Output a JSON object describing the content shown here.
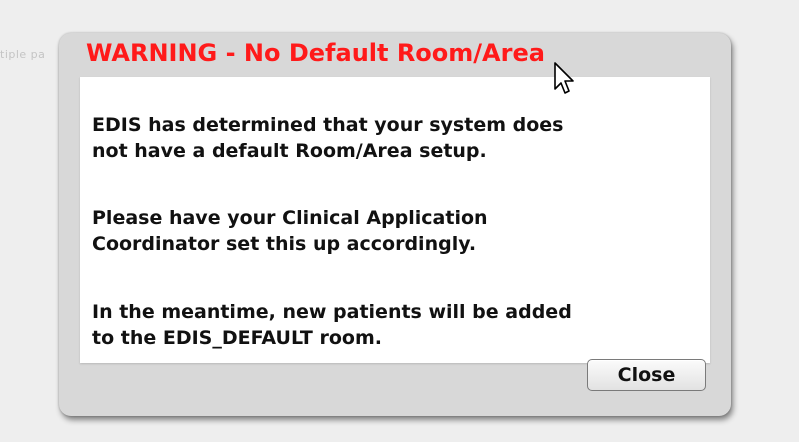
{
  "background": {
    "partial_text": "tiple pa"
  },
  "dialog": {
    "title": "WARNING - No Default Room/Area",
    "message": {
      "paragraph_1_line_1": "EDIS has determined that your system does",
      "paragraph_1_line_2": "not have a default Room/Area setup.",
      "paragraph_2_line_1": "Please have your Clinical Application",
      "paragraph_2_line_2": "Coordinator set this up accordingly.",
      "paragraph_3_line_1": "In the meantime, new patients will be added",
      "paragraph_3_line_2": "to the EDIS_DEFAULT room."
    },
    "close_label": "Close"
  },
  "colors": {
    "title": "#ff1a1a",
    "dialog_frame": "#d8d8d8",
    "page_background": "#eeeeee"
  },
  "icons": {
    "cursor": "mouse-pointer-icon"
  }
}
